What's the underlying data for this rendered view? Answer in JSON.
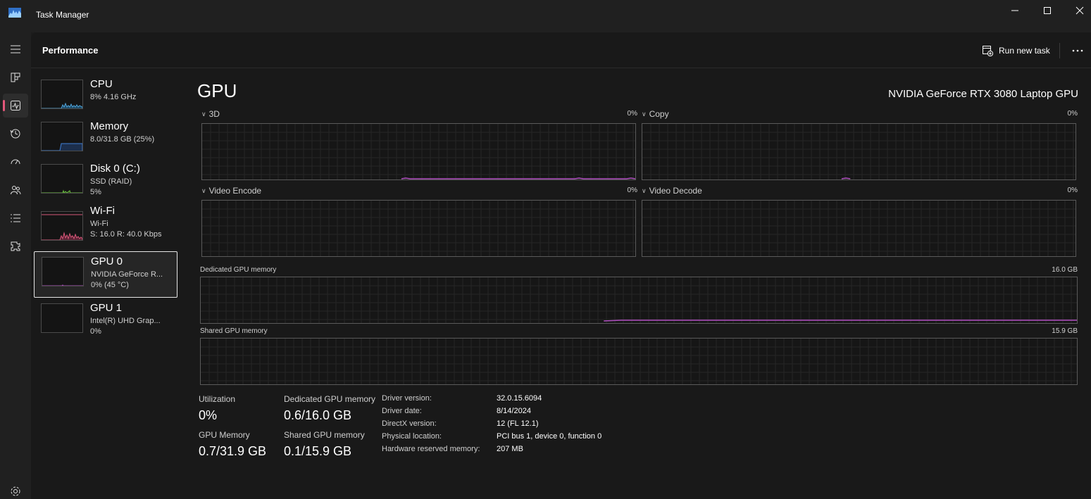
{
  "window": {
    "title": "Task Manager"
  },
  "header": {
    "title": "Performance",
    "run_task_label": "Run new task"
  },
  "nav": {
    "items": [
      "menu-icon",
      "processes-icon",
      "performance-icon",
      "app-history-icon",
      "startup-apps-icon",
      "users-icon",
      "details-icon",
      "services-icon"
    ],
    "active": "performance-icon",
    "accent": "#e3577a"
  },
  "devices": [
    {
      "name": "CPU",
      "sub1": "8% 4.16 GHz",
      "sub2": "",
      "color": "#4fa3d9"
    },
    {
      "name": "Memory",
      "sub1": "8.0/31.8 GB (25%)",
      "sub2": "",
      "color": "#3f7fd6"
    },
    {
      "name": "Disk 0 (C:)",
      "sub1": "SSD (RAID)",
      "sub2": "5%",
      "color": "#6bbf3f"
    },
    {
      "name": "Wi-Fi",
      "sub1": "Wi-Fi",
      "sub2": "S: 16.0  R: 40.0 Kbps",
      "color": "#d9577a"
    },
    {
      "name": "GPU 0",
      "sub1": "NVIDIA GeForce R...",
      "sub2": "0%  (45 °C)",
      "color": "#b04fc0",
      "selected": true
    },
    {
      "name": "GPU 1",
      "sub1": "Intel(R) UHD Grap...",
      "sub2": "0%",
      "color": "#b04fc0"
    }
  ],
  "gpu": {
    "title": "GPU",
    "model": "NVIDIA GeForce RTX 3080 Laptop GPU",
    "engines": [
      {
        "label": "3D",
        "pct": "0%"
      },
      {
        "label": "Copy",
        "pct": "0%"
      },
      {
        "label": "Video Encode",
        "pct": "0%"
      },
      {
        "label": "Video Decode",
        "pct": "0%"
      }
    ],
    "dedicated_label": "Dedicated GPU memory",
    "dedicated_cap": "16.0 GB",
    "shared_label": "Shared GPU memory",
    "shared_cap": "15.9 GB",
    "line_color": "#b04fc0"
  },
  "stats": {
    "utilization_label": "Utilization",
    "utilization_value": "0%",
    "dedicated_label": "Dedicated GPU memory",
    "dedicated_value": "0.6/16.0 GB",
    "gpu_memory_label": "GPU Memory",
    "gpu_memory_value": "0.7/31.9 GB",
    "shared_label": "Shared GPU memory",
    "shared_value": "0.1/15.9 GB"
  },
  "info": [
    {
      "key": "Driver version:",
      "value": "32.0.15.6094"
    },
    {
      "key": "Driver date:",
      "value": "8/14/2024"
    },
    {
      "key": "DirectX version:",
      "value": "12 (FL 12.1)"
    },
    {
      "key": "Physical location:",
      "value": "PCI bus 1, device 0, function 0"
    },
    {
      "key": "Hardware reserved memory:",
      "value": "207 MB"
    }
  ]
}
